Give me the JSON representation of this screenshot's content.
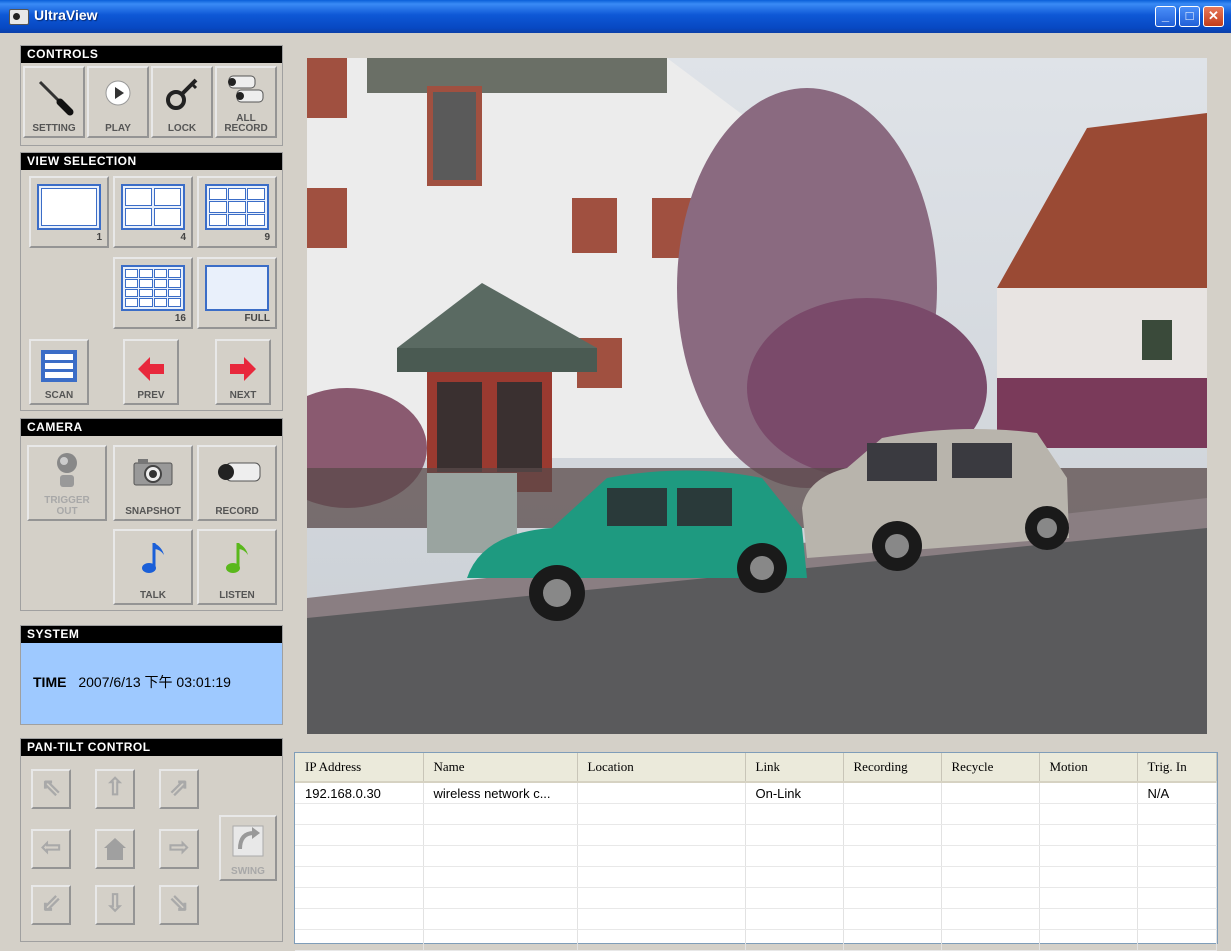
{
  "window": {
    "title": "UltraView"
  },
  "controls": {
    "header": "CONTROLS",
    "setting": "SETTING",
    "play": "PLAY",
    "lock": "LOCK",
    "all_record_line1": "ALL",
    "all_record_line2": "RECORD"
  },
  "view_selection": {
    "header": "VIEW SELECTION",
    "view1": "1",
    "view4": "4",
    "view9": "9",
    "view16": "16",
    "full": "FULL",
    "scan": "SCAN",
    "prev": "PREV",
    "next": "NEXT"
  },
  "camera": {
    "header": "CAMERA",
    "trigger_line1": "TRIGGER",
    "trigger_line2": "OUT",
    "snapshot": "SNAPSHOT",
    "record": "RECORD",
    "talk": "TALK",
    "listen": "LISTEN"
  },
  "system": {
    "header": "SYSTEM",
    "time_label": "TIME",
    "time_value": "2007/6/13 下午 03:01:19"
  },
  "pan_tilt": {
    "header": "PAN-TILT CONTROL",
    "swing": "SWING"
  },
  "device_list": {
    "columns": [
      "IP Address",
      "Name",
      "Location",
      "Link",
      "Recording",
      "Recycle",
      "Motion",
      "Trig. In"
    ],
    "rows": [
      [
        "192.168.0.30",
        "wireless network c...",
        "",
        "On-Link",
        "",
        "",
        "",
        "N/A"
      ]
    ]
  },
  "colors": {
    "titlebar": "#0748c2",
    "system_panel": "#9ec9ff",
    "panel_header": "#000000"
  }
}
